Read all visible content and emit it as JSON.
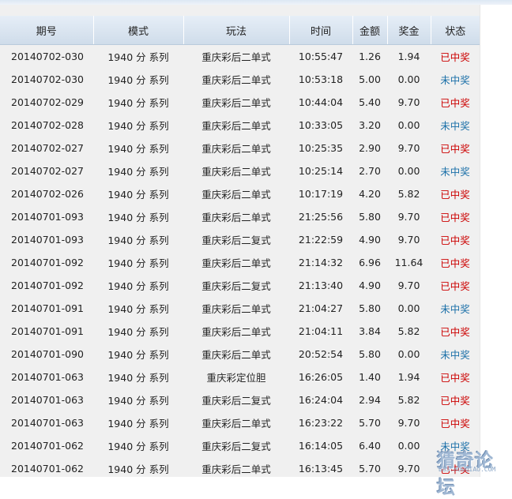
{
  "headers": {
    "period": "期号",
    "mode": "模式",
    "play": "玩法",
    "time": "时间",
    "amount": "金额",
    "prize": "奖金",
    "status": "状态"
  },
  "status_colors": {
    "win": "#cc0000",
    "lose": "#1a6fa8"
  },
  "rows": [
    {
      "period": "20140702-030",
      "mode": "1940 分 系列",
      "play": "重庆彩后二单式",
      "time": "10:55:47",
      "amount": "1.26",
      "prize": "1.94",
      "status": "已中奖",
      "win": true
    },
    {
      "period": "20140702-030",
      "mode": "1940 分 系列",
      "play": "重庆彩后二单式",
      "time": "10:53:18",
      "amount": "5.00",
      "prize": "0.00",
      "status": "未中奖",
      "win": false
    },
    {
      "period": "20140702-029",
      "mode": "1940 分 系列",
      "play": "重庆彩后二单式",
      "time": "10:44:04",
      "amount": "5.40",
      "prize": "9.70",
      "status": "已中奖",
      "win": true
    },
    {
      "period": "20140702-028",
      "mode": "1940 分 系列",
      "play": "重庆彩后二单式",
      "time": "10:33:05",
      "amount": "3.20",
      "prize": "0.00",
      "status": "未中奖",
      "win": false
    },
    {
      "period": "20140702-027",
      "mode": "1940 分 系列",
      "play": "重庆彩后二单式",
      "time": "10:25:35",
      "amount": "2.90",
      "prize": "9.70",
      "status": "已中奖",
      "win": true
    },
    {
      "period": "20140702-027",
      "mode": "1940 分 系列",
      "play": "重庆彩后二单式",
      "time": "10:25:14",
      "amount": "2.70",
      "prize": "0.00",
      "status": "未中奖",
      "win": false
    },
    {
      "period": "20140702-026",
      "mode": "1940 分 系列",
      "play": "重庆彩后二单式",
      "time": "10:17:19",
      "amount": "4.20",
      "prize": "5.82",
      "status": "已中奖",
      "win": true
    },
    {
      "period": "20140701-093",
      "mode": "1940 分 系列",
      "play": "重庆彩后二单式",
      "time": "21:25:56",
      "amount": "5.80",
      "prize": "9.70",
      "status": "已中奖",
      "win": true
    },
    {
      "period": "20140701-093",
      "mode": "1940 分 系列",
      "play": "重庆彩后二复式",
      "time": "21:22:59",
      "amount": "4.90",
      "prize": "9.70",
      "status": "已中奖",
      "win": true
    },
    {
      "period": "20140701-092",
      "mode": "1940 分 系列",
      "play": "重庆彩后二单式",
      "time": "21:14:32",
      "amount": "6.96",
      "prize": "11.64",
      "status": "已中奖",
      "win": true
    },
    {
      "period": "20140701-092",
      "mode": "1940 分 系列",
      "play": "重庆彩后二复式",
      "time": "21:13:40",
      "amount": "4.90",
      "prize": "9.70",
      "status": "已中奖",
      "win": true
    },
    {
      "period": "20140701-091",
      "mode": "1940 分 系列",
      "play": "重庆彩后二单式",
      "time": "21:04:27",
      "amount": "5.80",
      "prize": "0.00",
      "status": "未中奖",
      "win": false
    },
    {
      "period": "20140701-091",
      "mode": "1940 分 系列",
      "play": "重庆彩后二单式",
      "time": "21:04:11",
      "amount": "3.84",
      "prize": "5.82",
      "status": "已中奖",
      "win": true
    },
    {
      "period": "20140701-090",
      "mode": "1940 分 系列",
      "play": "重庆彩后二单式",
      "time": "20:52:54",
      "amount": "5.80",
      "prize": "0.00",
      "status": "未中奖",
      "win": false
    },
    {
      "period": "20140701-063",
      "mode": "1940 分 系列",
      "play": "重庆彩定位胆",
      "time": "16:26:05",
      "amount": "1.40",
      "prize": "1.94",
      "status": "已中奖",
      "win": true
    },
    {
      "period": "20140701-063",
      "mode": "1940 分 系列",
      "play": "重庆彩后二复式",
      "time": "16:24:04",
      "amount": "2.94",
      "prize": "5.82",
      "status": "已中奖",
      "win": true
    },
    {
      "period": "20140701-063",
      "mode": "1940 分 系列",
      "play": "重庆彩后二单式",
      "time": "16:23:22",
      "amount": "5.70",
      "prize": "9.70",
      "status": "已中奖",
      "win": true
    },
    {
      "period": "20140701-062",
      "mode": "1940 分 系列",
      "play": "重庆彩后二复式",
      "time": "16:14:05",
      "amount": "6.40",
      "prize": "0.00",
      "status": "未中奖",
      "win": false
    },
    {
      "period": "20140701-062",
      "mode": "1940 分 系列",
      "play": "重庆彩后二单式",
      "time": "16:13:45",
      "amount": "5.70",
      "prize": "9.70",
      "status": "已中奖",
      "win": true
    }
  ],
  "watermark": {
    "main": "猜奇论坛",
    "sub": "BBS.HOUQIAO.COM"
  }
}
